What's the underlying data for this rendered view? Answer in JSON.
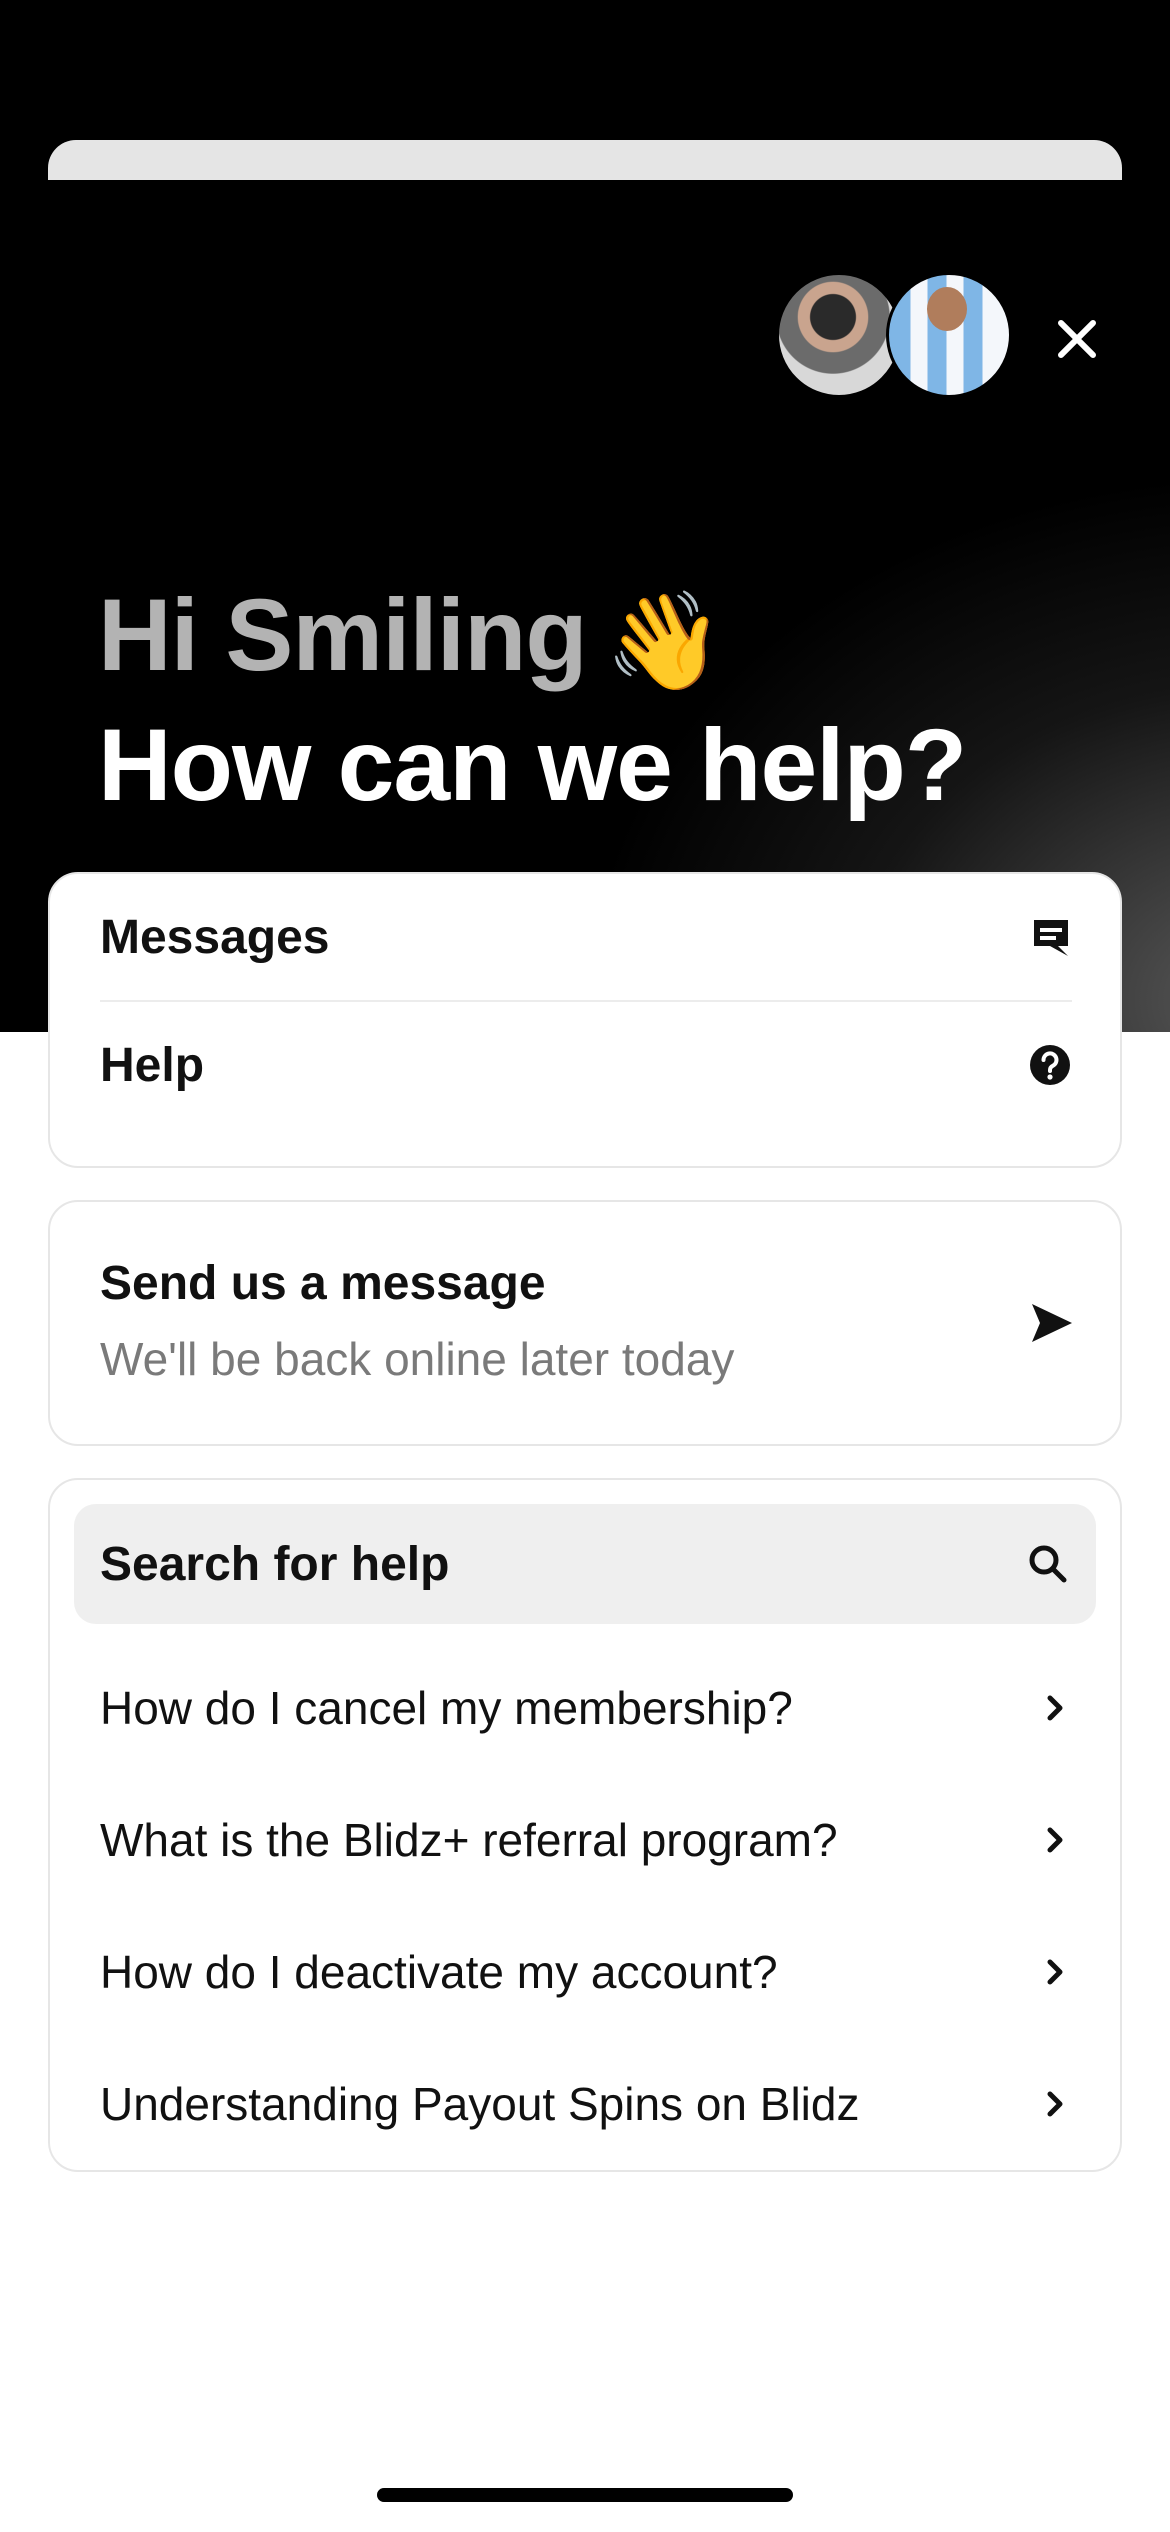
{
  "header": {
    "greeting": "Hi Smiling",
    "wave_emoji": "👋",
    "headline": "How can we help?",
    "avatars": [
      "team-member-avatar-1",
      "team-member-avatar-2"
    ]
  },
  "nav": {
    "messages_label": "Messages",
    "help_label": "Help"
  },
  "send_message": {
    "title": "Send us a message",
    "subtitle": "We'll be back online later today"
  },
  "help": {
    "search_label": "Search for help",
    "articles": [
      "How do I cancel my membership?",
      "What is the Blidz+ referral program?",
      "How do I deactivate my account?",
      "Understanding Payout Spins on Blidz"
    ]
  },
  "colors": {
    "hero_background": "#000000",
    "greeting_text": "#b3b3b3",
    "headline_text": "#ffffff",
    "secondary_text": "#7a7a7a",
    "search_background": "#efefef"
  }
}
